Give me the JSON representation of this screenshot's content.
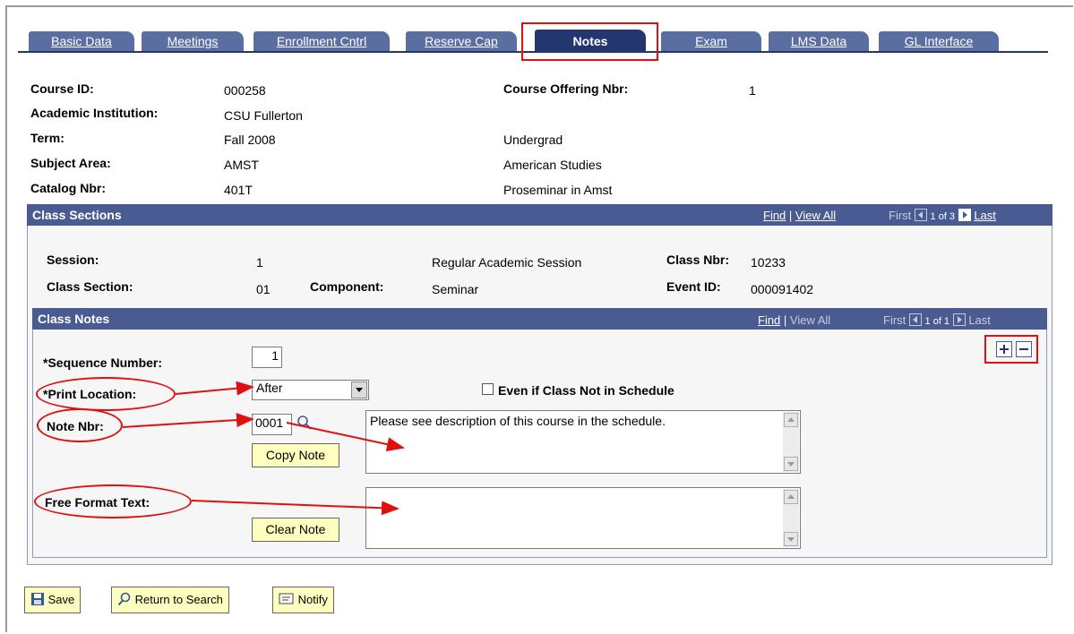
{
  "tabs": [
    "Basic Data",
    "Meetings",
    "Enrollment Cntrl",
    "Reserve Cap",
    "Notes",
    "Exam",
    "LMS Data",
    "GL Interface"
  ],
  "course": {
    "course_id_label": "Course ID:",
    "course_id": "000258",
    "offering_label": "Course Offering Nbr:",
    "offering": "1",
    "institution_label": "Academic Institution:",
    "institution": "CSU Fullerton",
    "term_label": "Term:",
    "term": "Fall 2008",
    "career": "Undergrad",
    "subject_label": "Subject Area:",
    "subject": "AMST",
    "subject_desc": "American Studies",
    "catalog_label": "Catalog Nbr:",
    "catalog": "401T",
    "catalog_desc": "Proseminar in Amst"
  },
  "class_sections": {
    "title": "Class Sections",
    "find": "Find",
    "view_all": "View All",
    "first": "First",
    "counter": "1 of 3",
    "last": "Last",
    "session_label": "Session:",
    "session": "1",
    "session_desc": "Regular Academic Session",
    "class_nbr_label": "Class Nbr:",
    "class_nbr": "10233",
    "section_label": "Class Section:",
    "section": "01",
    "component_label": "Component:",
    "component": "Seminar",
    "event_label": "Event ID:",
    "event": "000091402"
  },
  "class_notes": {
    "title": "Class Notes",
    "find": "Find",
    "view_all": "View All",
    "first": "First",
    "counter": "1 of 1",
    "last": "Last",
    "seq_label": "*Sequence Number:",
    "seq": "1",
    "print_label": "*Print Location:",
    "print": "After",
    "even_if_label": "Even if Class Not in Schedule",
    "note_nbr_label": "Note Nbr:",
    "note_nbr": "0001",
    "note_text": "Please see description of this course in the schedule.",
    "copy_note": "Copy Note",
    "free_label": "Free Format Text:",
    "clear_note": "Clear Note"
  },
  "footer": {
    "save": "Save",
    "return": "Return to Search",
    "notify": "Notify"
  },
  "colors": {
    "header": "#4a5b91",
    "tab": "#5b6ea1",
    "tab_active": "#23366e",
    "annotation": "#e01010",
    "button": "#ffffc0"
  }
}
